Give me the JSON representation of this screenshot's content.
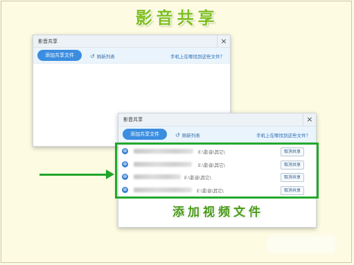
{
  "page_title": "影音共享",
  "caption": "添加视频文件",
  "colors": {
    "accent_green": "#22a82c",
    "button_blue": "#3b8de0",
    "background": "#fdfbe2"
  },
  "window_top": {
    "title": "影音共享",
    "close_label": "×",
    "add_button": "添加共享文件",
    "refresh_icon": "↺",
    "refresh_label": "刷新列表",
    "help_link": "手机上在哪找到这些文件？"
  },
  "window_bottom": {
    "title": "影音共享",
    "close_label": "×",
    "add_button": "添加共享文件",
    "refresh_icon": "↺",
    "refresh_label": "刷新列表",
    "help_link": "手机上在哪找到这些文件？",
    "files": [
      {
        "icon": "⊗",
        "path": "E:\\影音\\其它\\",
        "action": "取消共享"
      },
      {
        "icon": "⊗",
        "path": "E:\\影音\\其它\\",
        "action": "取消共享"
      },
      {
        "icon": "⊗",
        "path": "E:\\影音\\其它\\",
        "action": "取消共享"
      },
      {
        "icon": "⊗",
        "path": "E:\\影音\\其它\\",
        "action": "取消共享"
      }
    ]
  }
}
